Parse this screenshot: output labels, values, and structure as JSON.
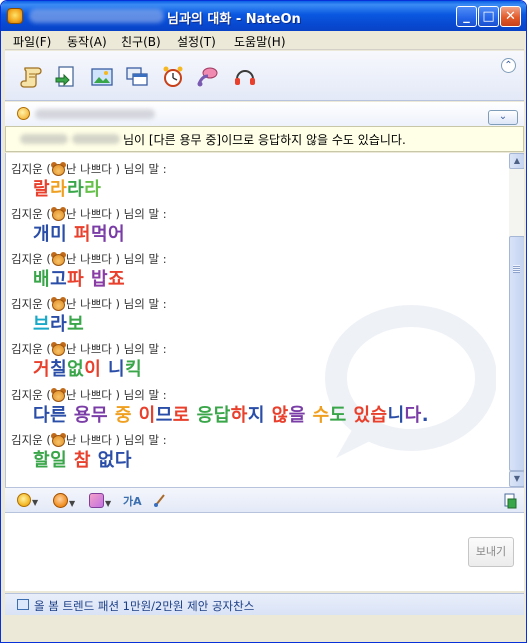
{
  "window": {
    "title": "님과의 대화  - NateOn"
  },
  "titlebar_buttons": {
    "minimize": "_",
    "maximize": "□",
    "close": "✕"
  },
  "menu": [
    "파일(F)",
    "동작(A)",
    "친구(B)",
    "설정(T)",
    "도움말(H)"
  ],
  "toolbar_icons": [
    "scroll-icon",
    "send-file-icon",
    "photo-icon",
    "window-share-icon",
    "alarm-clock-icon",
    "voice-call-icon",
    "headset-icon"
  ],
  "notice": {
    "text": "님이 [다른 용무 중]이므로 응답하지 않을 수도 있습니다."
  },
  "sender": {
    "name_prefix": "김지운 (",
    "name_suffix": "난 나쁘다 ) 님의 말 :"
  },
  "messages": [
    {
      "chars": [
        {
          "c": "랄",
          "color": "#e8402c"
        },
        {
          "c": "라",
          "color": "#f0a020"
        },
        {
          "c": "라",
          "color": "#3aa64a"
        },
        {
          "c": "라",
          "color": "#66c04a"
        }
      ]
    },
    {
      "chars": [
        {
          "c": "개",
          "color": "#2a4ea8"
        },
        {
          "c": "미",
          "color": "#2a4ea8"
        },
        {
          "c": " ",
          "color": "#000000"
        },
        {
          "c": "퍼",
          "color": "#e8402c"
        },
        {
          "c": "먹",
          "color": "#7a3ca6"
        },
        {
          "c": "어",
          "color": "#7a3ca6"
        }
      ]
    },
    {
      "chars": [
        {
          "c": "배",
          "color": "#3aa64a"
        },
        {
          "c": "고",
          "color": "#2a4ea8"
        },
        {
          "c": "파",
          "color": "#e8402c"
        },
        {
          "c": " ",
          "color": "#000000"
        },
        {
          "c": "밥",
          "color": "#8a3ca6"
        },
        {
          "c": "죠",
          "color": "#e8402c"
        }
      ]
    },
    {
      "chars": [
        {
          "c": "브",
          "color": "#18a8c8"
        },
        {
          "c": "라",
          "color": "#2a4ea8"
        },
        {
          "c": "보",
          "color": "#3aa64a"
        }
      ]
    },
    {
      "chars": [
        {
          "c": "거",
          "color": "#e8402c"
        },
        {
          "c": "칠",
          "color": "#2a4ea8"
        },
        {
          "c": "없",
          "color": "#3aa64a"
        },
        {
          "c": "이",
          "color": "#e8402c"
        },
        {
          "c": " ",
          "color": "#000000"
        },
        {
          "c": "니",
          "color": "#2a4ea8"
        },
        {
          "c": "킥",
          "color": "#3aa64a"
        }
      ]
    },
    {
      "chars": [
        {
          "c": "다",
          "color": "#2a4ea8"
        },
        {
          "c": "른",
          "color": "#2a4ea8"
        },
        {
          "c": " ",
          "color": "#000000"
        },
        {
          "c": "용",
          "color": "#7a3ca6"
        },
        {
          "c": "무",
          "color": "#7a3ca6"
        },
        {
          "c": " ",
          "color": "#000000"
        },
        {
          "c": "중",
          "color": "#f0a020"
        },
        {
          "c": " ",
          "color": "#000000"
        },
        {
          "c": "이",
          "color": "#e8402c"
        },
        {
          "c": "므",
          "color": "#2a4ea8"
        },
        {
          "c": "로",
          "color": "#e8402c"
        },
        {
          "c": " ",
          "color": "#000000"
        },
        {
          "c": "응",
          "color": "#3aa64a"
        },
        {
          "c": "답",
          "color": "#3aa64a"
        },
        {
          "c": "하",
          "color": "#e8402c"
        },
        {
          "c": "지",
          "color": "#2a4ea8"
        },
        {
          "c": " ",
          "color": "#000000"
        },
        {
          "c": "않",
          "color": "#e8402c"
        },
        {
          "c": "을",
          "color": "#7a3ca6"
        },
        {
          "c": " ",
          "color": "#000000"
        },
        {
          "c": "수",
          "color": "#f0a020"
        },
        {
          "c": "도",
          "color": "#3aa64a"
        },
        {
          "c": " ",
          "color": "#000000"
        },
        {
          "c": "있",
          "color": "#e8402c"
        },
        {
          "c": "습",
          "color": "#e8402c"
        },
        {
          "c": "니",
          "color": "#2a4ea8"
        },
        {
          "c": "다",
          "color": "#7a3ca6"
        },
        {
          "c": ".",
          "color": "#2a4ea8"
        }
      ]
    },
    {
      "chars": [
        {
          "c": "할",
          "color": "#3aa64a"
        },
        {
          "c": "일",
          "color": "#3aa64a"
        },
        {
          "c": " ",
          "color": "#000000"
        },
        {
          "c": "참",
          "color": "#e8402c"
        },
        {
          "c": " ",
          "color": "#000000"
        },
        {
          "c": "없",
          "color": "#2a4ea8"
        },
        {
          "c": "다",
          "color": "#2a4ea8"
        }
      ]
    }
  ],
  "format_toolbar": {
    "font_label": "가A"
  },
  "send_button": "보내기",
  "status": {
    "text": "올 봄 트렌드 패션 1만원/2만원 제안 공자찬스"
  }
}
